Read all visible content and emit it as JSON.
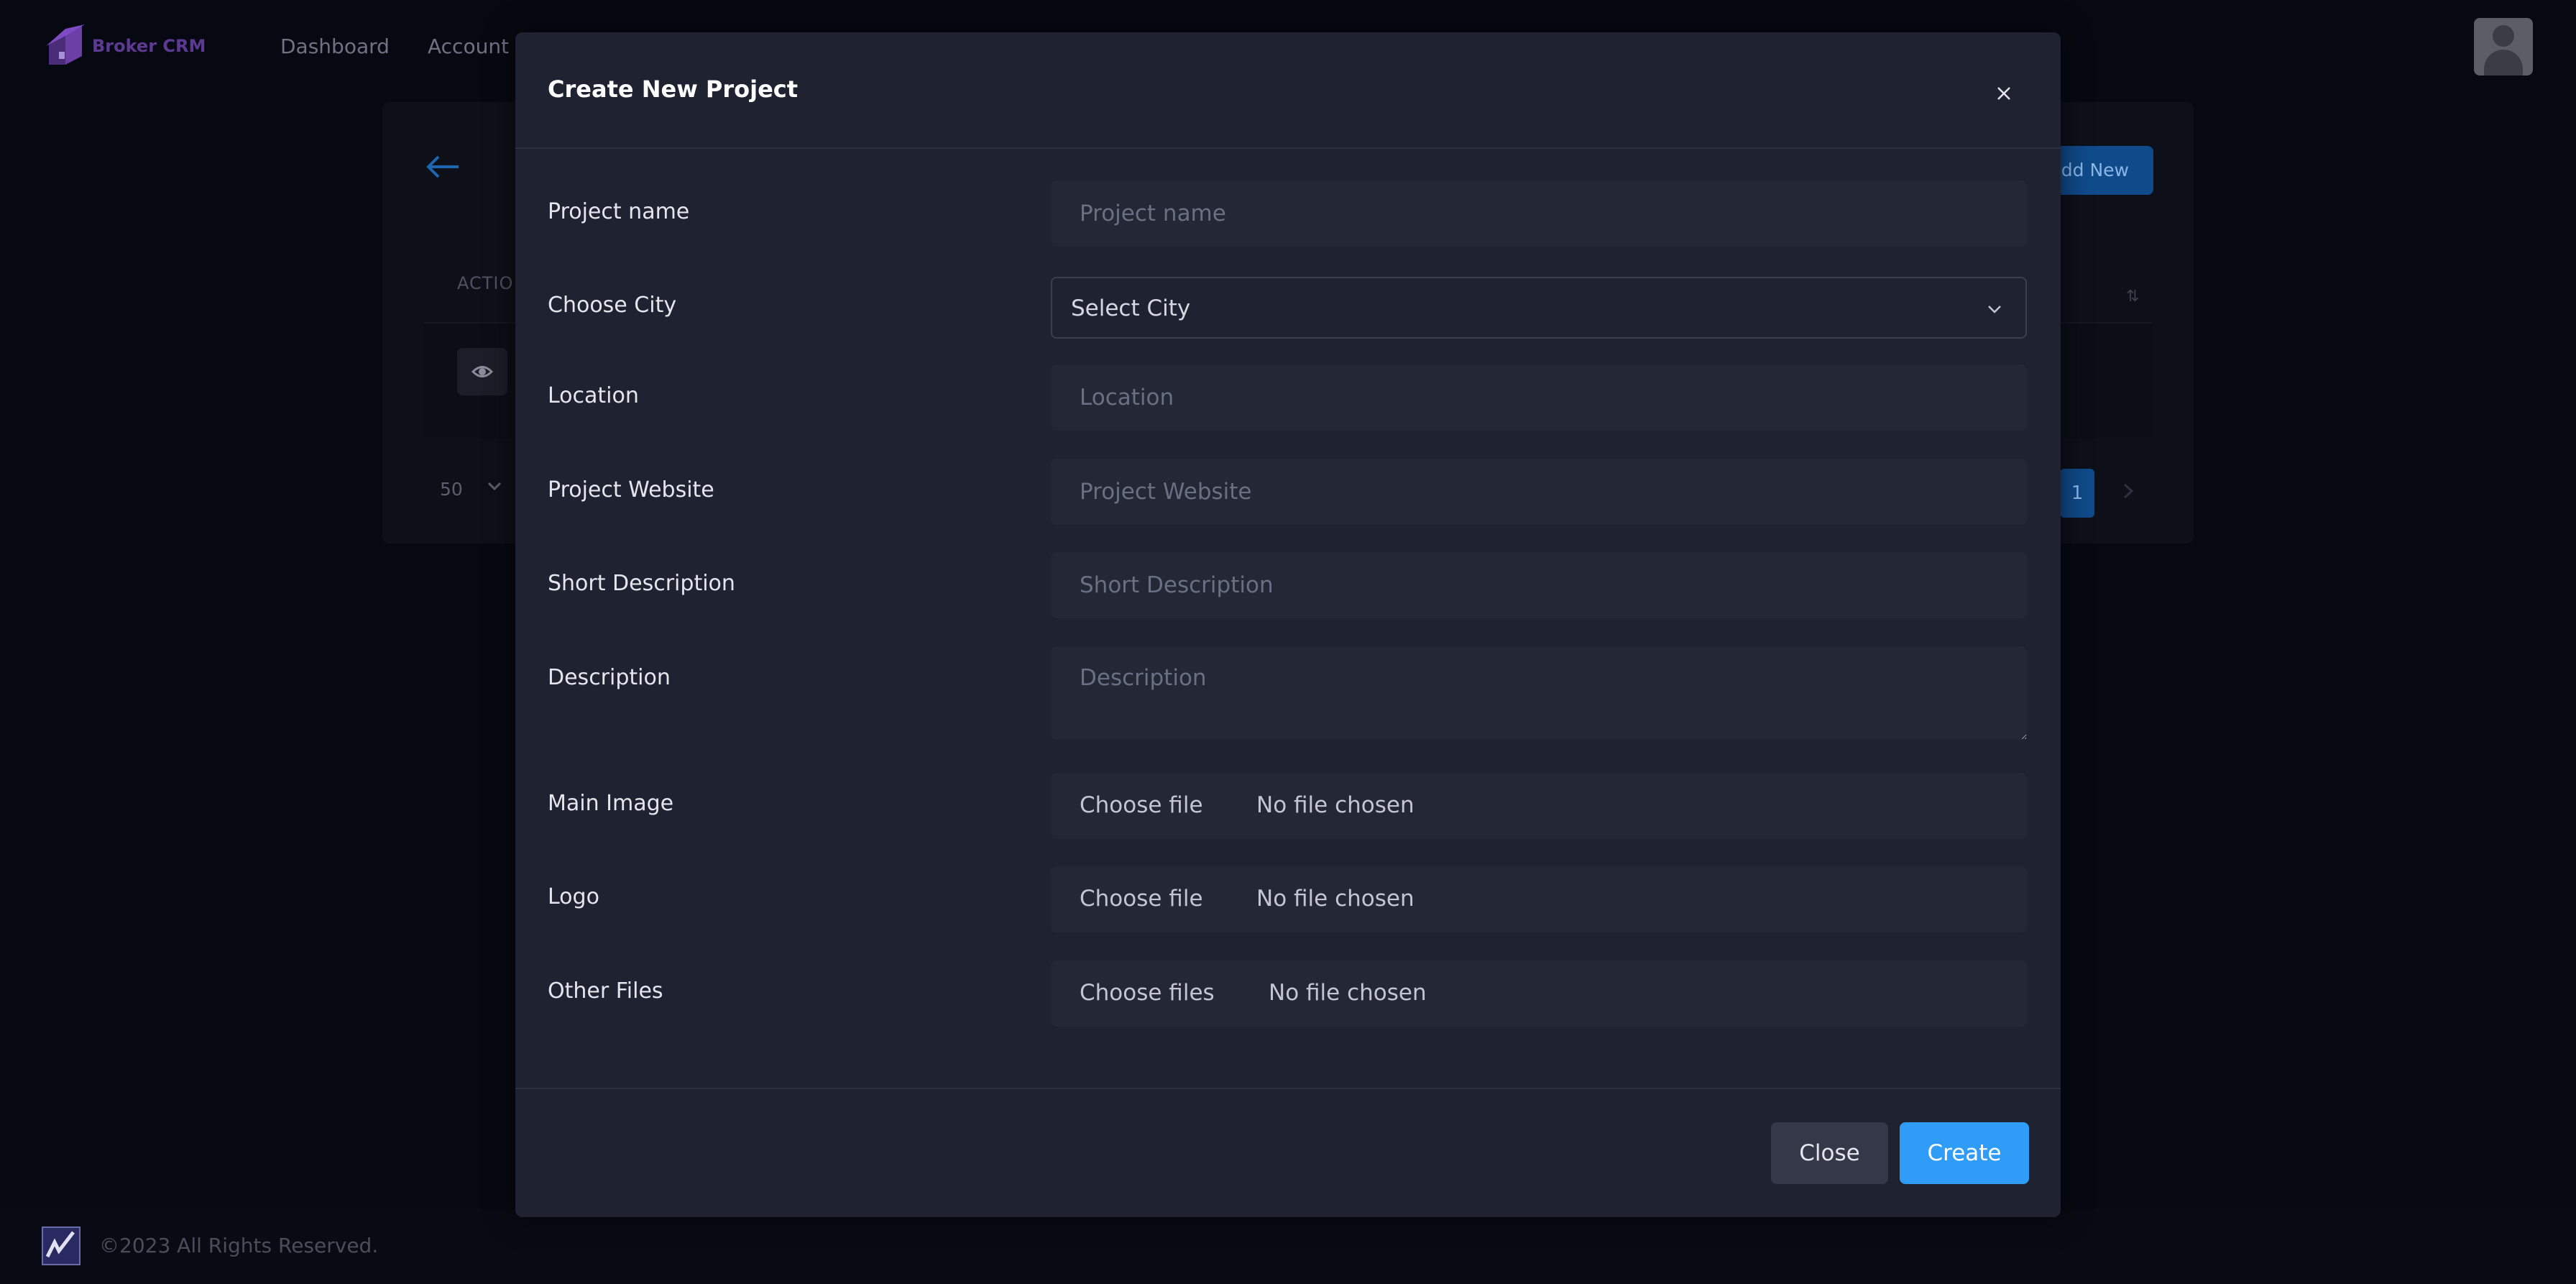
{
  "app": {
    "brand_name": "Broker CRM",
    "nav": [
      {
        "label": "Dashboard"
      },
      {
        "label": "Account"
      }
    ]
  },
  "background": {
    "add_button_label": "dd New",
    "table_header_action": "ACTIO",
    "page_size": "50",
    "current_page": "1"
  },
  "modal": {
    "title": "Create New Project",
    "fields": {
      "project_name": {
        "label": "Project name",
        "placeholder": "Project name"
      },
      "city": {
        "label": "Choose City",
        "selected": "Select City"
      },
      "location": {
        "label": "Location",
        "placeholder": "Location"
      },
      "website": {
        "label": "Project Website",
        "placeholder": "Project Website"
      },
      "short_description": {
        "label": "Short Description",
        "placeholder": "Short Description"
      },
      "description": {
        "label": "Description",
        "placeholder": "Description"
      },
      "main_image": {
        "label": "Main Image",
        "button": "Choose file",
        "status": "No file chosen"
      },
      "logo": {
        "label": "Logo",
        "button": "Choose file",
        "status": "No file chosen"
      },
      "other_files": {
        "label": "Other Files",
        "button": "Choose files",
        "status": "No file chosen"
      }
    },
    "buttons": {
      "close": "Close",
      "create": "Create"
    }
  },
  "footer": {
    "copyright": "©2023 All Rights Reserved."
  },
  "colors": {
    "page_bg": "#070912",
    "modal_bg": "#1f2230",
    "input_bg": "#242736",
    "primary": "#2f9cf7",
    "secondary_button": "#343849",
    "brand_purple": "#5d3a91"
  }
}
